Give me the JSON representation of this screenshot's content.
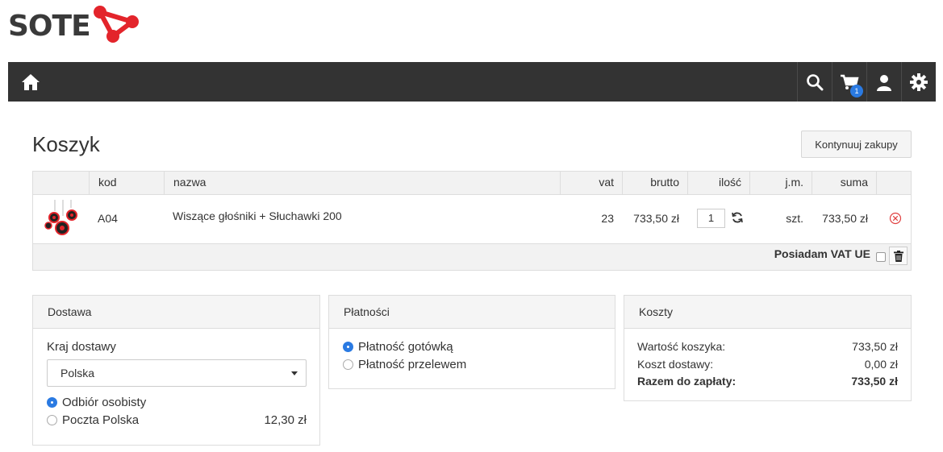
{
  "logo": {
    "text": "SOTE"
  },
  "header": {
    "home_icon": "home-icon",
    "search_icon": "search-icon",
    "cart_icon": "cart-icon",
    "cart_count": "1",
    "user_icon": "user-icon",
    "settings_icon": "gear-icon"
  },
  "page": {
    "title": "Koszyk",
    "continue_label": "Kontynuuj zakupy"
  },
  "cart": {
    "columns": {
      "kod": "kod",
      "nazwa": "nazwa",
      "vat": "vat",
      "brutto": "brutto",
      "ilosc": "ilość",
      "jm": "j.m.",
      "suma": "suma"
    },
    "items": [
      {
        "kod": "A04",
        "nazwa": "Wiszące głośniki + Słuchawki 200",
        "vat": "23",
        "brutto": "733,50 zł",
        "ilosc": "1",
        "jm": "szt.",
        "suma": "733,50 zł"
      }
    ],
    "vat_ue_label": "Posiadam VAT UE"
  },
  "delivery": {
    "title": "Dostawa",
    "country_label": "Kraj dostawy",
    "country_value": "Polska",
    "options": [
      {
        "label": "Odbiór osobisty",
        "price": "",
        "selected": true
      },
      {
        "label": "Poczta Polska",
        "price": "12,30 zł",
        "selected": false
      }
    ]
  },
  "payment": {
    "title": "Płatności",
    "options": [
      {
        "label": "Płatność gotówką",
        "selected": true
      },
      {
        "label": "Płatność przelewem",
        "selected": false
      }
    ]
  },
  "costs": {
    "title": "Koszty",
    "cart_value_label": "Wartość koszyka:",
    "cart_value": "733,50 zł",
    "shipping_label": "Koszt dostawy:",
    "shipping_value": "0,00 zł",
    "total_label": "Razem do zapłaty:",
    "total_value": "733,50 zł"
  },
  "colors": {
    "navbar": "#333333",
    "accent": "#2a7ae2",
    "logo_red": "#e3242b",
    "remove_red": "#e04040"
  }
}
